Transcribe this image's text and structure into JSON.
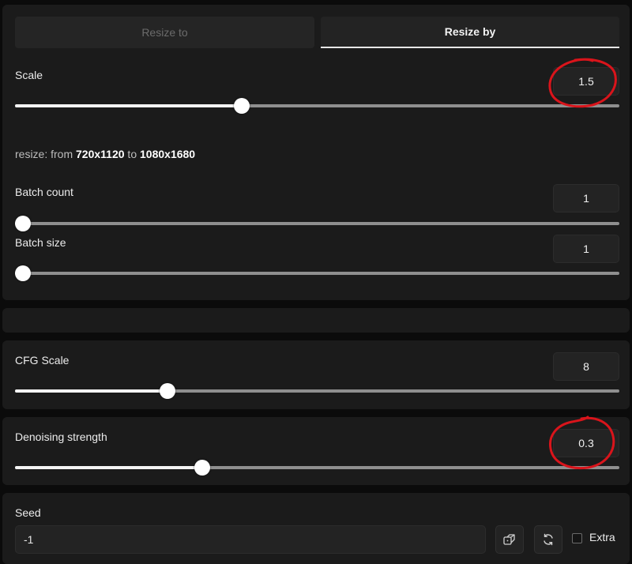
{
  "tabs": [
    {
      "label": "Resize to",
      "active": false
    },
    {
      "label": "Resize by",
      "active": true
    }
  ],
  "scale": {
    "label": "Scale",
    "value": "1.5",
    "fraction": 0.372
  },
  "resize_info": {
    "prefix": "resize: from ",
    "from": "720x1120",
    "middle": " to ",
    "to": "1080x1680"
  },
  "batch_count": {
    "label": "Batch count",
    "value": "1",
    "fraction": 0.0
  },
  "batch_size": {
    "label": "Batch size",
    "value": "1",
    "fraction": 0.0
  },
  "cfg_scale": {
    "label": "CFG Scale",
    "value": "8",
    "fraction": 0.246
  },
  "denoising": {
    "label": "Denoising strength",
    "value": "0.3",
    "fraction": 0.305
  },
  "seed": {
    "label": "Seed",
    "value": "-1",
    "extra_label": "Extra",
    "extra_checked": false
  },
  "icons": {
    "dice": "dice-icon",
    "recycle": "recycle-icon"
  },
  "colors": {
    "annotation": "#d9141b",
    "background": "#0b0b0b",
    "panel": "#1b1b1b"
  }
}
